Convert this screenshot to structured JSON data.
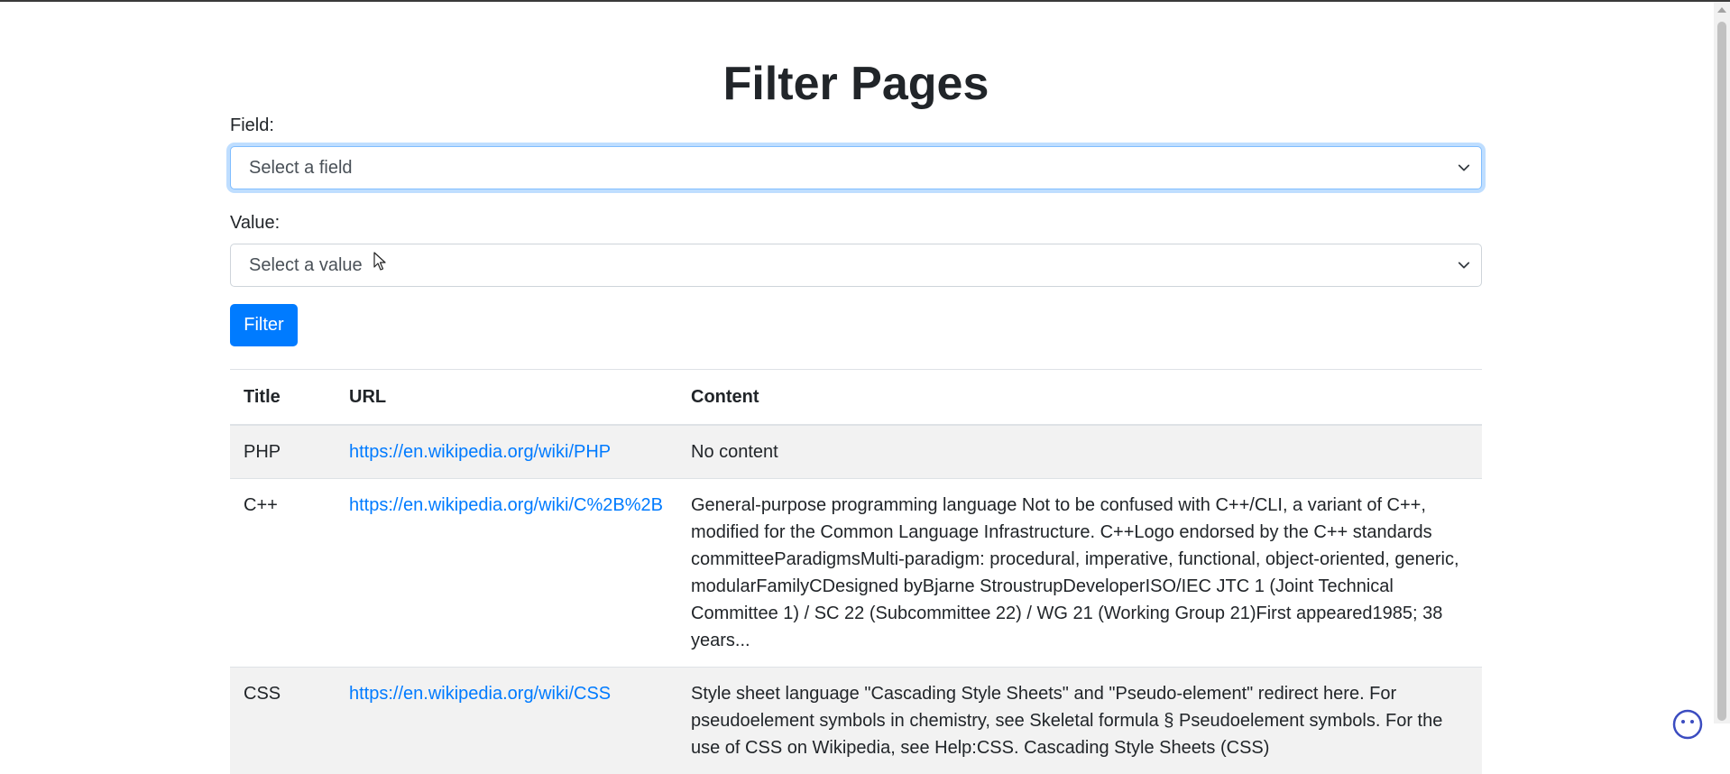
{
  "page": {
    "title": "Filter Pages"
  },
  "form": {
    "field_label": "Field:",
    "field_selected": "Select a field",
    "value_label": "Value:",
    "value_selected": "Select a value",
    "filter_button": "Filter"
  },
  "table": {
    "headers": [
      "Title",
      "URL",
      "Content"
    ],
    "rows": [
      {
        "title": "PHP",
        "url": "https://en.wikipedia.org/wiki/PHP",
        "content": "No content"
      },
      {
        "title": "C++",
        "url": "https://en.wikipedia.org/wiki/C%2B%2B",
        "content": "General-purpose programming language Not to be confused with C++/CLI, a variant of C++, modified for the Common Language Infrastructure. C++Logo endorsed by the C++ standards committeeParadigmsMulti-paradigm: procedural, imperative, functional, object-oriented, generic, modularFamilyCDesigned byBjarne StroustrupDeveloperISO/IEC JTC 1 (Joint Technical Committee 1) / SC 22 (Subcommittee 22) / WG 21 (Working Group 21)First appeared1985; 38 years..."
      },
      {
        "title": "CSS",
        "url": "https://en.wikipedia.org/wiki/CSS",
        "content": "Style sheet language \"Cascading Style Sheets\" and \"Pseudo-element\" redirect here. For pseudoelement symbols in chemistry, see Skeletal formula § Pseudoelement symbols. For the use of CSS on Wikipedia, see Help:CSS. Cascading Style Sheets (CSS)"
      }
    ]
  },
  "icons": {
    "select_chevron": "chevron-down-icon",
    "cursor": "mouse-pointer-icon",
    "corner_badge": "smiley-icon"
  },
  "colors": {
    "primary": "#007bff",
    "link": "#007bff",
    "stripe": "#f2f2f2",
    "focus_border": "#80bdff"
  }
}
